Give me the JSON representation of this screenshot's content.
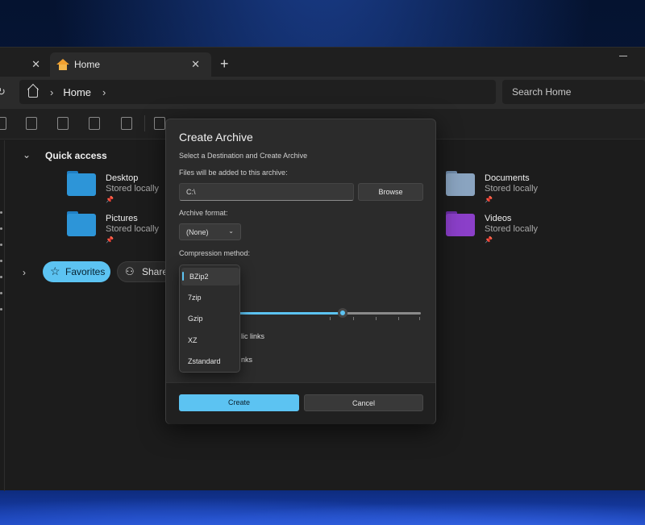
{
  "tabs": [
    {
      "label": ""
    },
    {
      "label": "Home"
    }
  ],
  "address": {
    "crumb": "Home",
    "search_placeholder": "Search Home"
  },
  "quick_access": {
    "title": "Quick access",
    "items": [
      {
        "name": "Desktop",
        "status": "Stored locally",
        "color": "#2d95d8"
      },
      {
        "name": "Pictures",
        "status": "Stored locally",
        "color": "#2d95d8"
      },
      {
        "name": "Documents",
        "status": "Stored locally",
        "color": "#8aa4c0"
      },
      {
        "name": "Videos",
        "status": "Stored locally",
        "color": "#8b3fc9"
      }
    ]
  },
  "filters": {
    "favorites": "Favorites",
    "shared": "Shared"
  },
  "dialog": {
    "title": "Create Archive",
    "subtitle": "Select a Destination and Create Archive",
    "files_label": "Files will be added to this archive:",
    "path_value": "C:\\",
    "browse_label": "Browse",
    "format_label": "Archive format:",
    "format_value": "(None)",
    "compression_label": "Compression method:",
    "compression_options": [
      "BZip2",
      "7zip",
      "Gzip",
      "XZ",
      "Zstandard"
    ],
    "selected_compression": "BZip2",
    "level_fraction": 0.57,
    "symlinks_visible": "lic links",
    "hardlinks_visible": "nks",
    "create_label": "Create",
    "cancel_label": "Cancel"
  },
  "colors": {
    "accent": "#5cc3f2",
    "window_bg": "#1c1c1c",
    "dialog_bg": "#2b2b2b"
  }
}
